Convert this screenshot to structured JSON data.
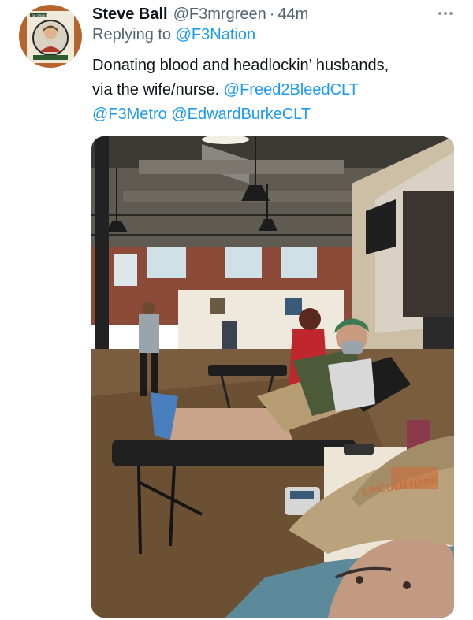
{
  "tweet": {
    "author_name": "Steve Ball",
    "author_handle": "@F3mrgreen",
    "separator": "·",
    "timestamp": "44m",
    "reply_prefix": "Replying to",
    "reply_to": "@F3Nation",
    "text_line1": "Donating blood and headlockin’ husbands,",
    "text_line2_plain": "via the wife/nurse.",
    "mention_1": "@Freed2BleedCLT",
    "mention_2": "@F3Metro",
    "mention_3": "@EdwardBurkeCLT",
    "avatar_badge_text": "SB GREEN"
  },
  "photo": {
    "hat_logo_text": "LINCOLN HARR"
  },
  "colors": {
    "link": "#1d9bf0",
    "secondary_text": "#536471",
    "primary_text": "#0f1419"
  },
  "icons": {
    "more": "more-options-icon"
  }
}
